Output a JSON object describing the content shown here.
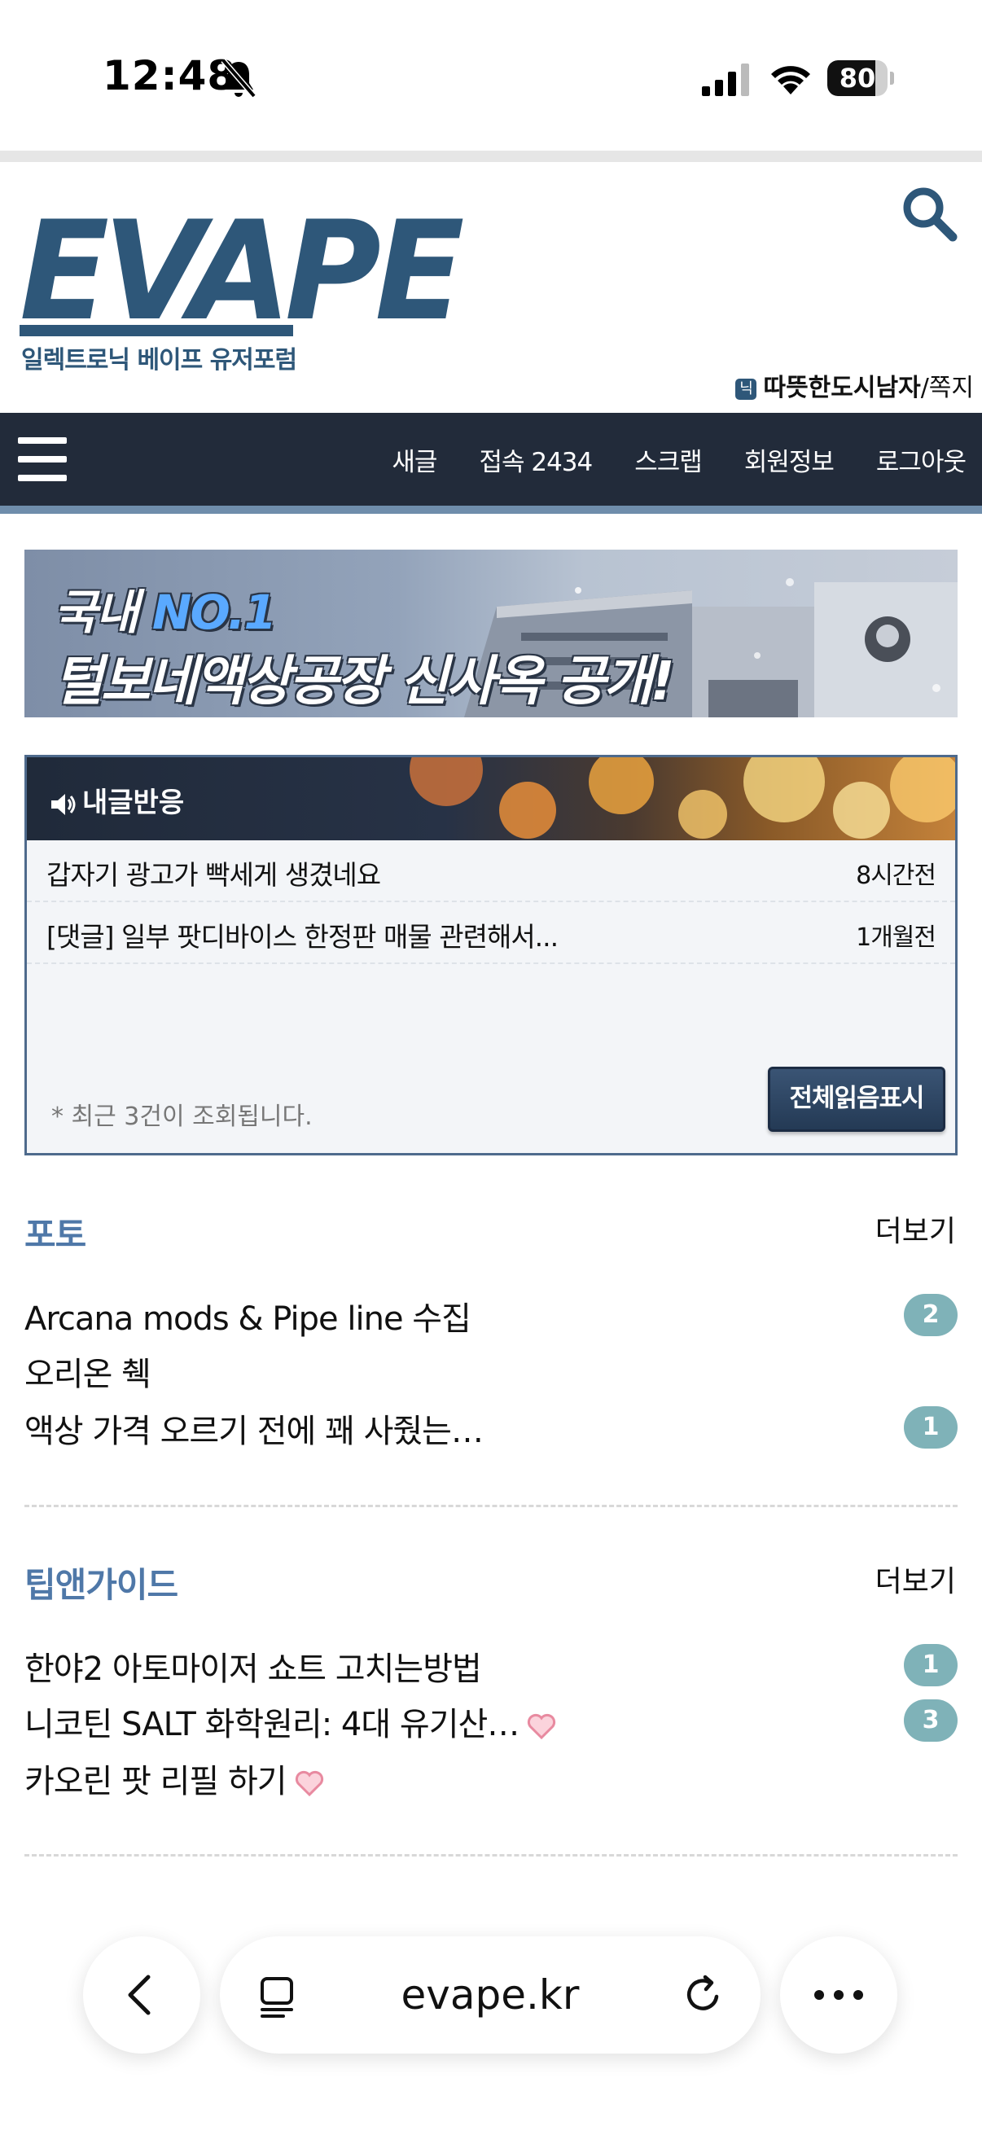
{
  "status_bar": {
    "time": "12:48",
    "battery": "80",
    "battery_level": 0.8
  },
  "header": {
    "logo_text": "EVAPE",
    "logo_subtitle": "일렉트로닉 베이프 유저포럼",
    "user_badge": "닉",
    "username": "따뜻한도시남자",
    "message_link": "/쪽지"
  },
  "nav": {
    "items": [
      "새글",
      "접속 2434",
      "스크랩",
      "회원정보",
      "로그아웃"
    ]
  },
  "banner": {
    "line1_prefix": "국내 ",
    "line1_highlight": "NO.1",
    "line2": "털보네액상공장 신사옥 공개!"
  },
  "reactions": {
    "title": "내글반응",
    "items": [
      {
        "text": "갑자기 광고가 빡세게 생겼네요",
        "time": "8시간전"
      },
      {
        "text": "[댓글] 일부 팟디바이스 한정판 매물 관련해서...",
        "time": "1개월전"
      }
    ],
    "note": "* 최근 3건이 조회됩니다.",
    "mark_all_button": "전체읽음표시"
  },
  "sections": [
    {
      "title": "포토",
      "more": "더보기",
      "items": [
        {
          "text": "Arcana mods & Pipe line 수집",
          "count": "2",
          "heart": false
        },
        {
          "text": "오리온 췍",
          "count": "",
          "heart": false
        },
        {
          "text": "액상 가격 오르기 전에 꽤 사줬는…",
          "count": "1",
          "heart": false
        }
      ]
    },
    {
      "title": "팁앤가이드",
      "more": "더보기",
      "items": [
        {
          "text": "한야2 아토마이저 쇼트 고치는방법",
          "count": "1",
          "heart": false
        },
        {
          "text": "니코틴 SALT 화학원리: 4대 유기산…",
          "count": "3",
          "heart": true
        },
        {
          "text": "카오린 팟 리필 하기",
          "count": "",
          "heart": true
        }
      ]
    }
  ],
  "browser": {
    "url": "evape.kr"
  },
  "colors": {
    "brand": "#2e5779",
    "nav_bg": "#222b3a",
    "section_title": "#4f78a8",
    "count_badge": "#7fb2b8"
  }
}
